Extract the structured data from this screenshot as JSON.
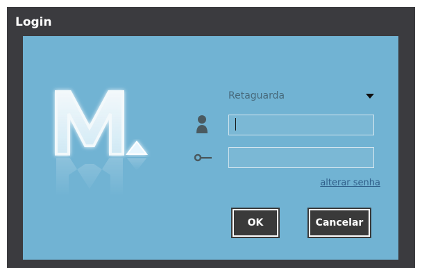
{
  "window": {
    "title": "Login"
  },
  "logo": {
    "letter": "M."
  },
  "form": {
    "profile_selected": "Retaguarda",
    "username_value": "",
    "password_value": "",
    "change_password_link": "alterar senha"
  },
  "buttons": {
    "ok": "OK",
    "cancel": "Cancelar"
  },
  "colors": {
    "panel": "#71b3d3",
    "frame": "#3b3b3f",
    "button": "#3a3a3a"
  }
}
